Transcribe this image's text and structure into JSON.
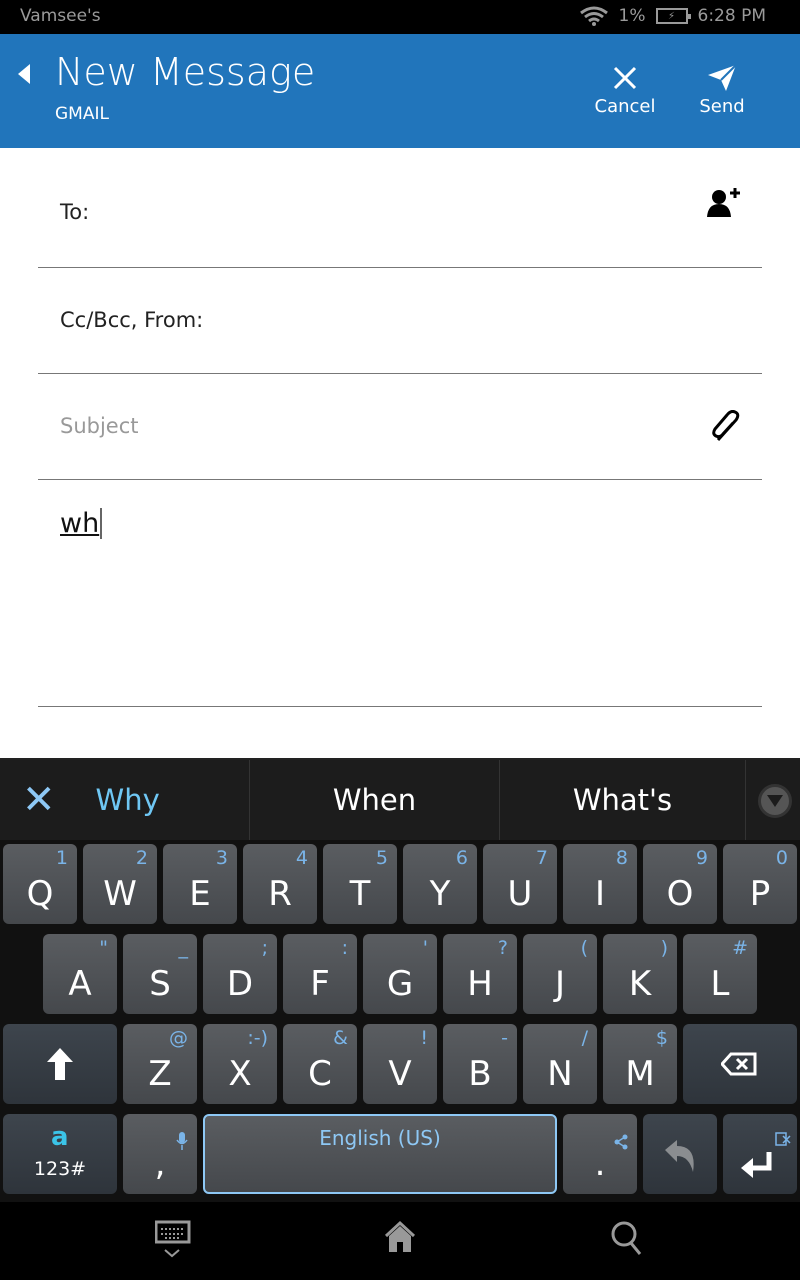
{
  "status_bar": {
    "owner": "Vamsee's",
    "battery": "1%",
    "time": "6:28 PM"
  },
  "header": {
    "title": "New Message",
    "subtitle": "GMAIL",
    "cancel_label": "Cancel",
    "send_label": "Send"
  },
  "form": {
    "to_label": "To:",
    "cc_label": "Cc/Bcc, From:",
    "subject_placeholder": "Subject",
    "body_value": "wh"
  },
  "suggestions": [
    "Why",
    "When",
    "What's"
  ],
  "keys": {
    "row1": [
      [
        "Q",
        "1"
      ],
      [
        "W",
        "2"
      ],
      [
        "E",
        "3"
      ],
      [
        "R",
        "4"
      ],
      [
        "T",
        "5"
      ],
      [
        "Y",
        "6"
      ],
      [
        "U",
        "7"
      ],
      [
        "I",
        "8"
      ],
      [
        "O",
        "9"
      ],
      [
        "P",
        "0"
      ]
    ],
    "row2": [
      [
        "A",
        "\""
      ],
      [
        "S",
        "_"
      ],
      [
        "D",
        ";"
      ],
      [
        "F",
        ":"
      ],
      [
        "G",
        "'"
      ],
      [
        "H",
        "?"
      ],
      [
        "J",
        "("
      ],
      [
        "K",
        ")"
      ],
      [
        "L",
        "#"
      ]
    ],
    "row3": [
      [
        "Z",
        "@"
      ],
      [
        "X",
        ":-)"
      ],
      [
        "C",
        "&"
      ],
      [
        "V",
        "!"
      ],
      [
        "B",
        "-"
      ],
      [
        "N",
        "/"
      ],
      [
        "M",
        "$"
      ]
    ],
    "symbols_label": "123#",
    "comma": ",",
    "space_label": "English (US)",
    "period": "."
  }
}
